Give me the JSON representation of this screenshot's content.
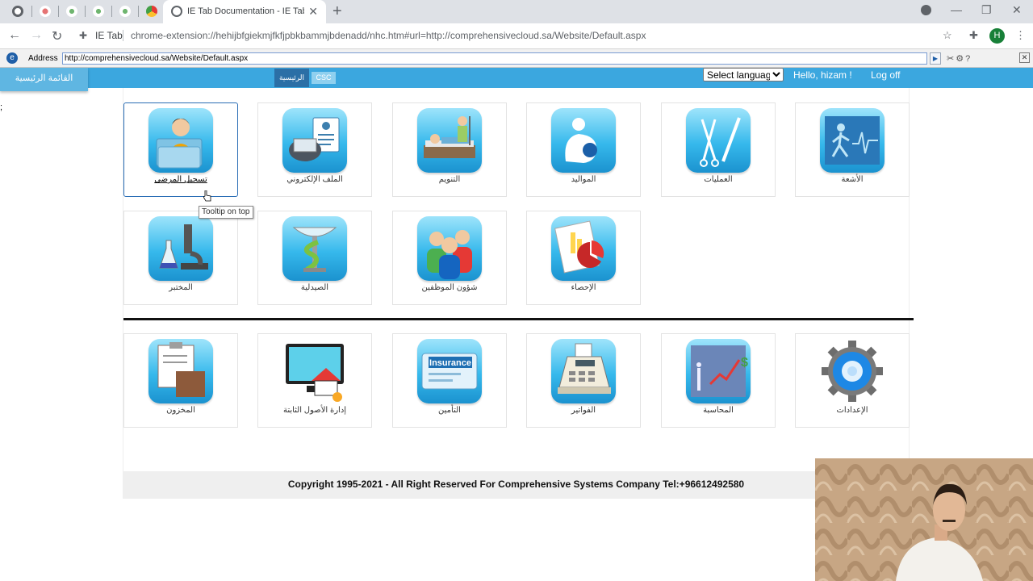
{
  "browser": {
    "active_tab_title": "IE Tab Documentation - IE Tab - I",
    "new_tab_label": "+",
    "omnibox_label": "IE Tab",
    "omnibox_url": "chrome-extension://hehijbfgiekmjfkfjpbkbammjbdenadd/nhc.htm#url=http://comprehensivecloud.sa/Website/Default.aspx",
    "profile_initial": "H"
  },
  "ietab": {
    "address_label": "Address",
    "address_value": "http://comprehensivecloud.sa/Website/Default.aspx"
  },
  "header": {
    "main_menu": "القائمة الرئيسية",
    "home_tab": "الرئيسية",
    "csc_tab": "CSC",
    "language_placeholder": "Select language",
    "greeting": "Hello, hizam !",
    "logoff": "Log off",
    "stray_text": ";"
  },
  "modules": [
    {
      "label": "تسجيل المرضى",
      "icon": "patient-registration-icon"
    },
    {
      "label": "الملف الإلكتروني",
      "icon": "electronic-record-icon"
    },
    {
      "label": "التنويم",
      "icon": "inpatient-icon"
    },
    {
      "label": "المواليد",
      "icon": "births-icon"
    },
    {
      "label": "العمليات",
      "icon": "surgery-icon"
    },
    {
      "label": "الأشعة",
      "icon": "radiology-icon"
    },
    {
      "label": "المختبر",
      "icon": "laboratory-icon"
    },
    {
      "label": "الصيدلية",
      "icon": "pharmacy-icon"
    },
    {
      "label": "شؤون الموظفين",
      "icon": "staff-affairs-icon"
    },
    {
      "label": "الإحصاء",
      "icon": "statistics-icon"
    }
  ],
  "admin_modules": [
    {
      "label": "المخزون",
      "icon": "inventory-icon"
    },
    {
      "label": "إدارة الأصول الثابتة",
      "icon": "fixed-assets-icon"
    },
    {
      "label": "التأمين",
      "icon": "insurance-icon",
      "icon_text": "Insurance"
    },
    {
      "label": "الفواتير",
      "icon": "invoices-icon"
    },
    {
      "label": "المحاسبة",
      "icon": "accounting-icon"
    },
    {
      "label": "الإعدادات",
      "icon": "settings-gear-icon"
    }
  ],
  "tooltip": "Tooltip on top",
  "footer": "Copyright 1995-2021 - All Right Reserved For Comprehensive Systems Company Tel:+96612492580",
  "colors": {
    "site_header": "#3ba7df",
    "home_tab": "#2b6fa6",
    "tile_selected_border": "#2a6db5"
  }
}
